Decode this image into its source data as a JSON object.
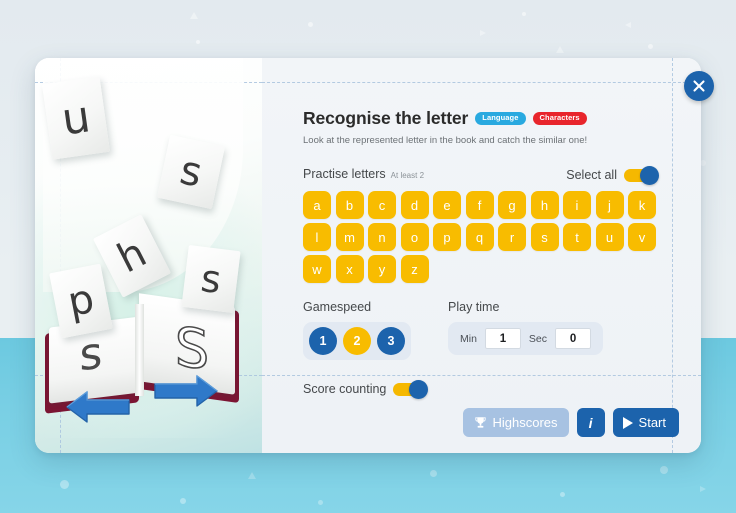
{
  "window": {
    "close_label": "×"
  },
  "header": {
    "title": "Recognise the letter",
    "badges": [
      {
        "label": "Language",
        "color": "#29a9e0"
      },
      {
        "label": "Characters",
        "color": "#e8252c"
      }
    ],
    "subtitle": "Look at the represented letter in the book and catch the similar one!"
  },
  "practise": {
    "label": "Practise letters",
    "note": "At least 2",
    "select_all_label": "Select all",
    "select_all_on": true,
    "letters": [
      "a",
      "b",
      "c",
      "d",
      "e",
      "f",
      "g",
      "h",
      "i",
      "j",
      "k",
      "l",
      "m",
      "n",
      "o",
      "p",
      "q",
      "r",
      "s",
      "t",
      "u",
      "v",
      "w",
      "x",
      "y",
      "z"
    ]
  },
  "gamespeed": {
    "label": "Gamespeed",
    "options": [
      "1",
      "2",
      "3"
    ],
    "selected": "2"
  },
  "playtime": {
    "label": "Play time",
    "min_label": "Min",
    "min_value": "1",
    "sec_label": "Sec",
    "sec_value": "0"
  },
  "score": {
    "label": "Score counting",
    "on": true
  },
  "footer": {
    "highscores_label": "Highscores",
    "info_label": "i",
    "start_label": "Start"
  },
  "illustration": {
    "floating_letters": [
      "u",
      "s",
      "h",
      "s"
    ],
    "book_letters": [
      "p",
      "s",
      "S"
    ]
  },
  "colors": {
    "accent_blue": "#1c63ac",
    "accent_yellow": "#f8bc00",
    "badge_language": "#29a9e0",
    "badge_characters": "#e8252c",
    "page_bottom": "#79cfe4",
    "book_cover": "#7b1533"
  }
}
